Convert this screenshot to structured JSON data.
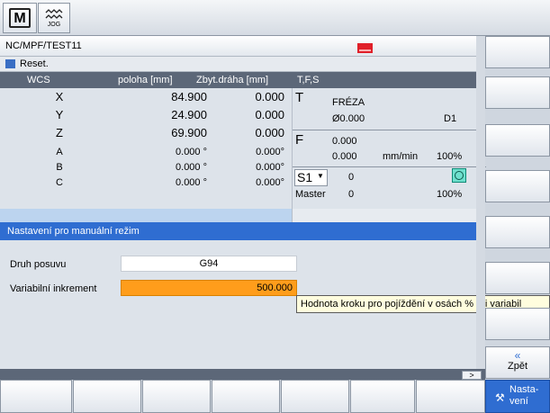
{
  "topbar": {
    "m_icon": "M",
    "jog_icon_label": "JOG"
  },
  "program_path": "NC/MPF/TEST11",
  "reset_status": "Reset.",
  "wcs": {
    "headers": {
      "wcs": "WCS",
      "position": "poloha [mm]",
      "remaining": "Zbyt.dráha [mm]"
    },
    "rows": [
      {
        "axis": "X",
        "position": "84.900",
        "remaining": "0.000"
      },
      {
        "axis": "Y",
        "position": "24.900",
        "remaining": "0.000"
      },
      {
        "axis": "Z",
        "position": "69.900",
        "remaining": "0.000"
      },
      {
        "axis": "A",
        "position": "0.000 °",
        "remaining": "0.000°"
      },
      {
        "axis": "B",
        "position": "0.000 °",
        "remaining": "0.000°"
      },
      {
        "axis": "C",
        "position": "0.000 °",
        "remaining": "0.000°"
      }
    ]
  },
  "tfs": {
    "header": "T,F,S",
    "t_label": "T",
    "tool_name": "FRÉZA",
    "tool_diameter": "Ø0.000",
    "tool_d": "D1",
    "f_label": "F",
    "feed_value": "0.000",
    "feed_actual": "0.000",
    "feed_unit": "mm/min",
    "feed_override": "100%",
    "spindle_select": "S1",
    "spindle_value": "0",
    "master_label": "Master",
    "master_value": "0",
    "spindle_override": "100%"
  },
  "settings": {
    "title": "Nastavení pro manuální režim",
    "feed_type_label": "Druh posuvu",
    "feed_type_value": "G94",
    "increment_label": "Variabilní inkrement",
    "increment_value": "500.000",
    "tooltip": "Hodnota kroku pro pojíždění v osách % při variabil"
  },
  "softkeys": {
    "back_label": "Zpět",
    "back_chevron": "«",
    "settings_label_1": "Nasta-",
    "settings_label_2": "vení"
  },
  "scroll_arrow": ">",
  "colors": {
    "accent": "#2f6dd1",
    "highlight": "#ff9d1b",
    "alarm": "#e0202a",
    "header": "#5c6778"
  }
}
